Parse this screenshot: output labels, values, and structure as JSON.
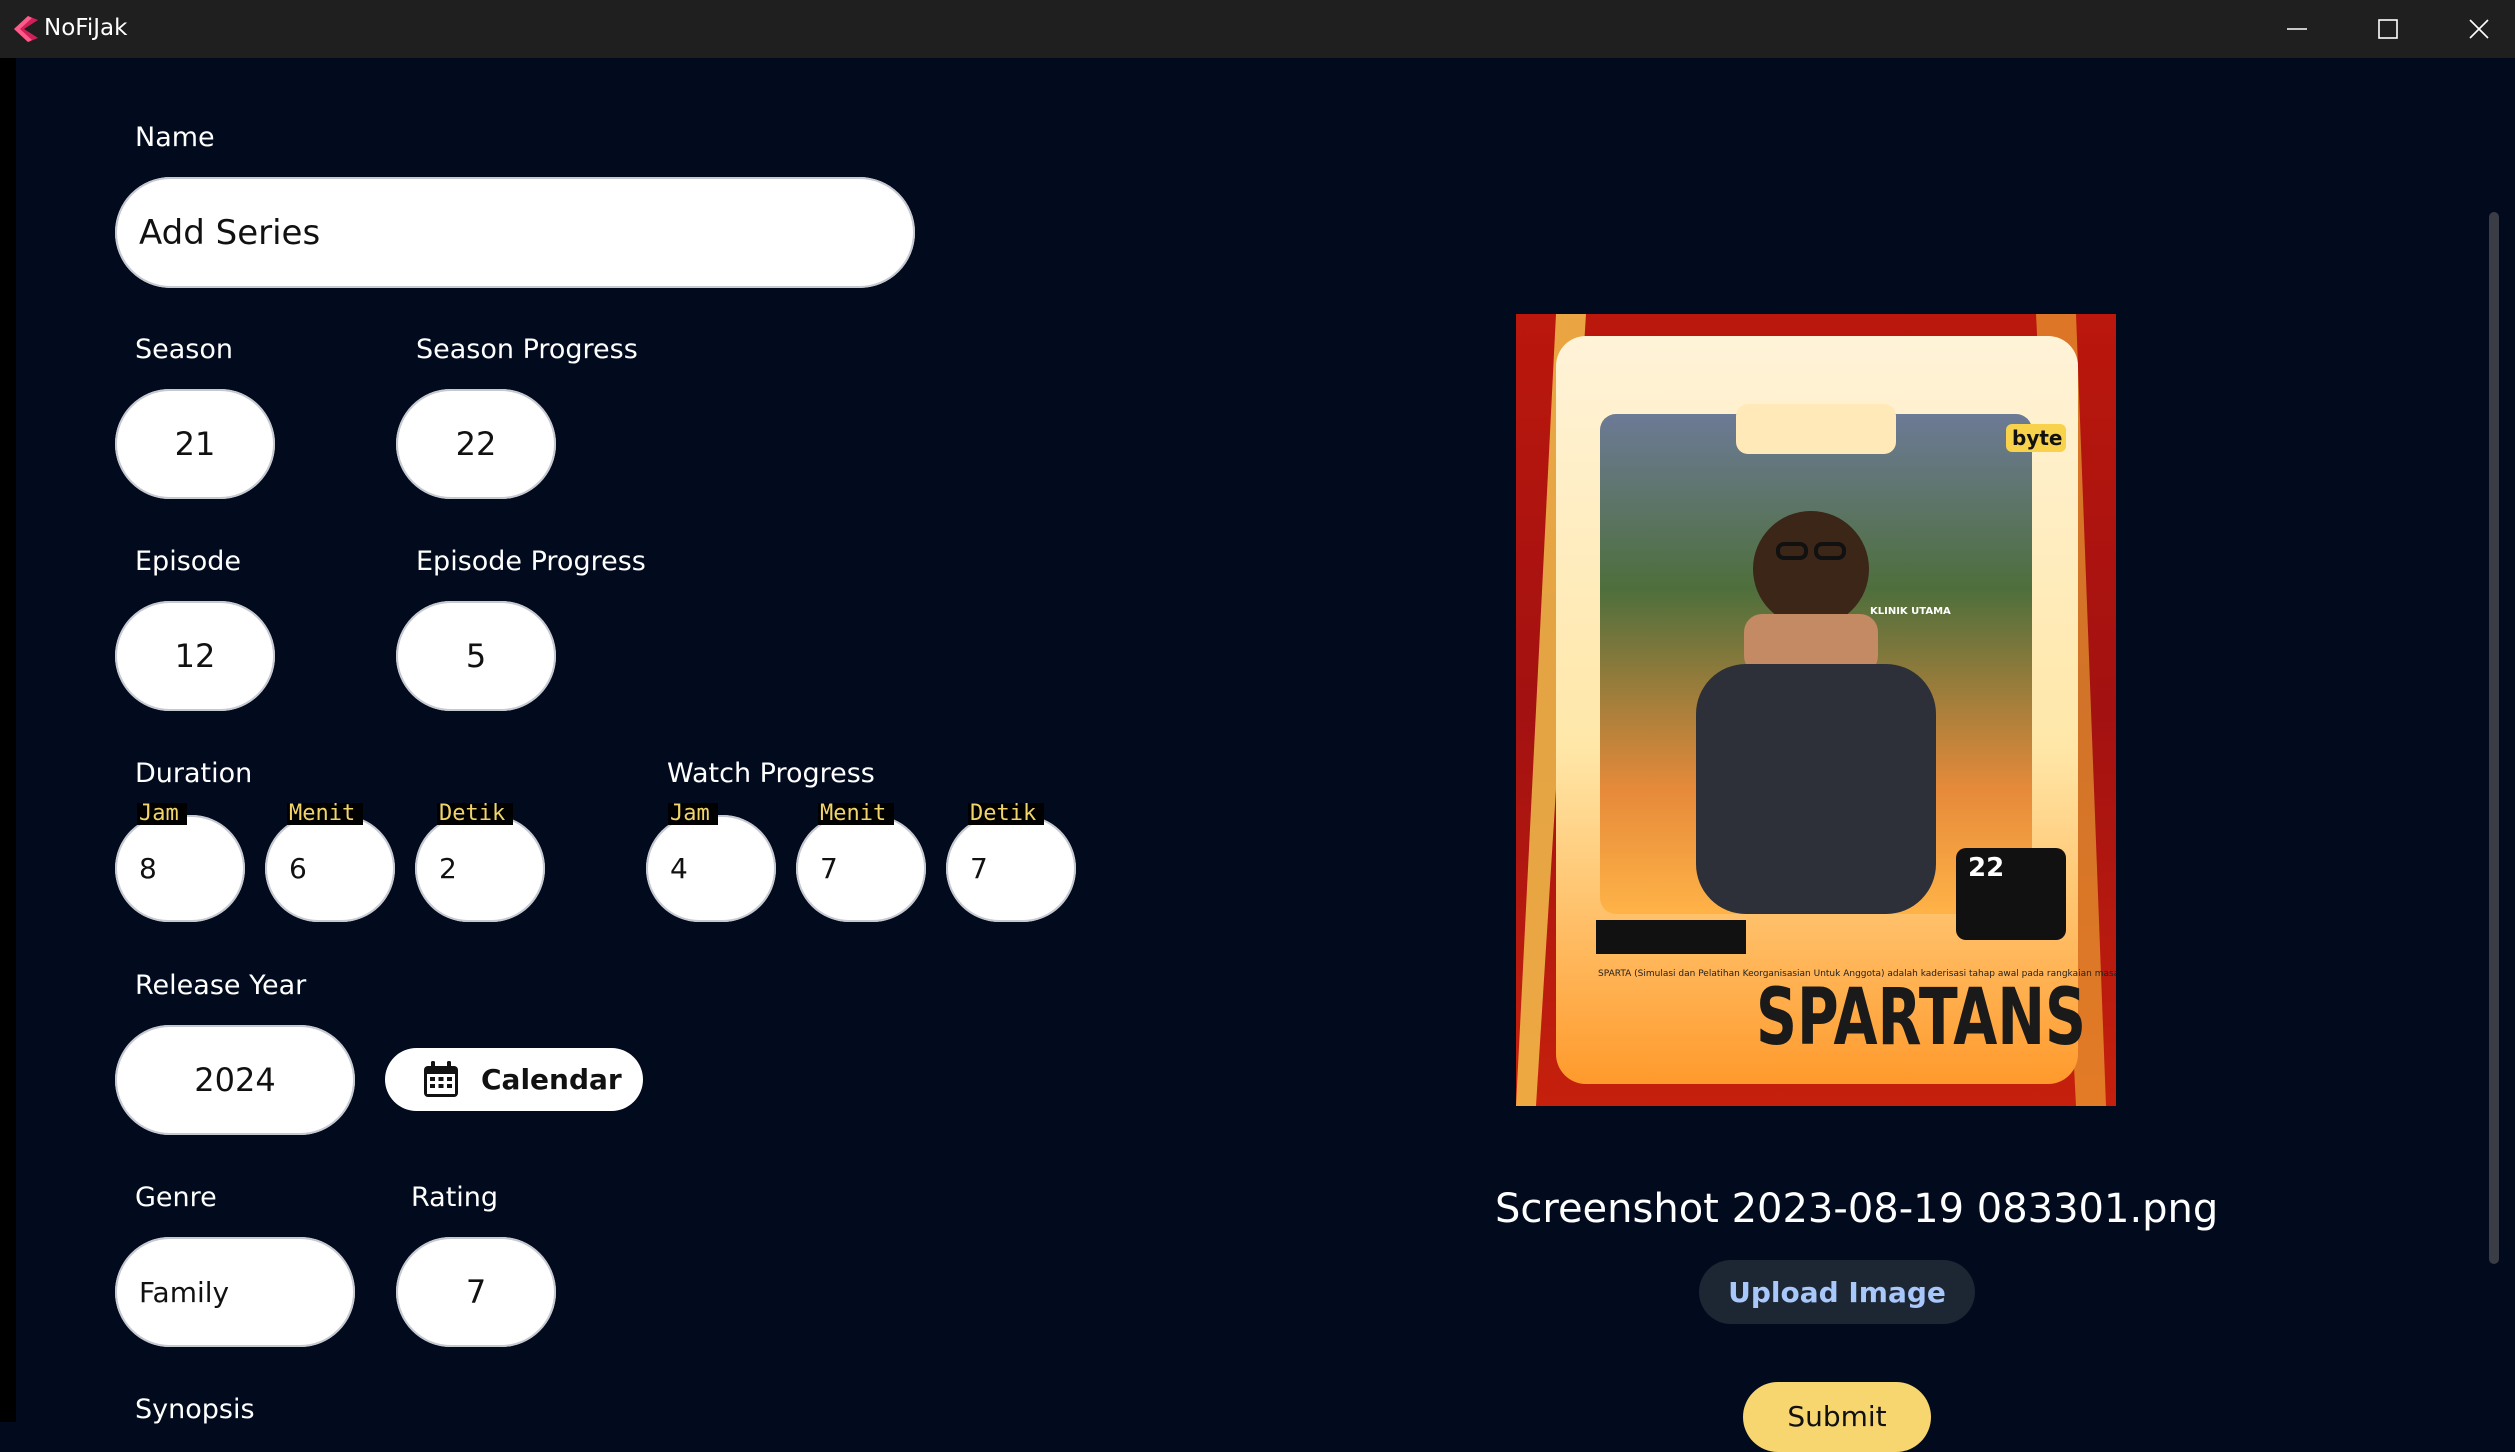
{
  "window": {
    "title": "NoFiJak"
  },
  "form": {
    "name": {
      "label": "Name",
      "value": "Add Series"
    },
    "season": {
      "label": "Season",
      "value": "21"
    },
    "season_progress": {
      "label": "Season Progress",
      "value": "22"
    },
    "episode": {
      "label": "Episode",
      "value": "12"
    },
    "episode_progress": {
      "label": "Episode Progress",
      "value": "5"
    },
    "duration": {
      "label": "Duration",
      "hours": {
        "tag": "Jam",
        "value": "8"
      },
      "minutes": {
        "tag": "Menit",
        "value": "6"
      },
      "seconds": {
        "tag": "Detik",
        "value": "2"
      }
    },
    "watch_progress": {
      "label": "Watch Progress",
      "hours": {
        "tag": "Jam",
        "value": "4"
      },
      "minutes": {
        "tag": "Menit",
        "value": "7"
      },
      "seconds": {
        "tag": "Detik",
        "value": "7"
      }
    },
    "release_year": {
      "label": "Release Year",
      "value": "2024",
      "calendar_label": "Calendar"
    },
    "genre": {
      "label": "Genre",
      "value": "Family"
    },
    "rating": {
      "label": "Rating",
      "value": "7"
    },
    "synopsis": {
      "label": "Synopsis"
    }
  },
  "image_panel": {
    "filename": "Screenshot 2023-08-19 083301.png",
    "upload_label": "Upload Image",
    "submit_label": "Submit",
    "poster": {
      "number": "22",
      "brand": "byte",
      "headline": "SPARTANS",
      "caption": "SPARTA (Simulasi dan Pelatihan Keorganisasian Untuk Anggota) adalah kaderisasi tahap awal pada rangkaian masa orientasi anggota muda Himpunan Mahasiswa Informatika ITB",
      "sign_text": "KLINIK UTAMA"
    }
  },
  "colors": {
    "background": "#020b1e",
    "titlebar": "#1f1f1f",
    "submit": "#f7d670",
    "upload_text": "#a8c7fa",
    "tag_text": "#f2d46a"
  }
}
